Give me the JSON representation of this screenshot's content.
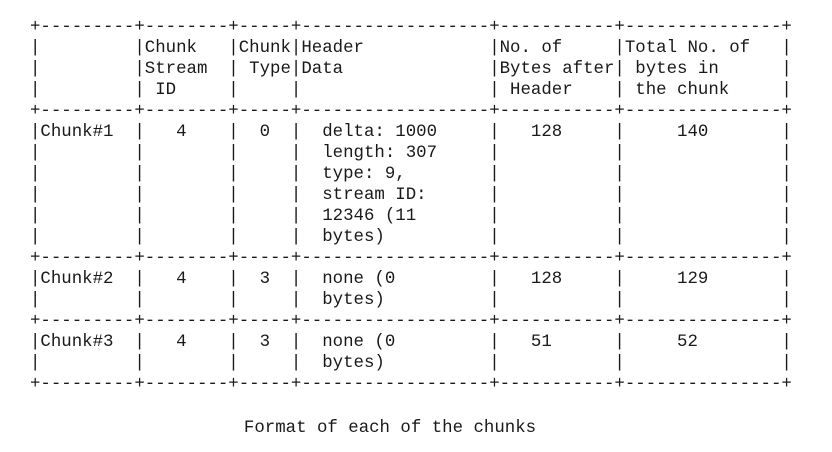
{
  "table_text": "+---------+--------+-----+------------------+-----------+---------------+\n|         |Chunk   |Chunk|Header            |No. of     |Total No. of   |\n|         |Stream  | Type|Data              |Bytes after| bytes in      |\n|         | ID     |     |                  | Header    | the chunk     |\n+---------+--------+-----+------------------+-----------+---------------+\n|Chunk#1  |   4    |  0  |  delta: 1000     |   128     |     140       |\n|         |        |     |  length: 307     |           |               |\n|         |        |     |  type: 9,        |           |               |\n|         |        |     |  stream ID:      |           |               |\n|         |        |     |  12346 (11       |           |               |\n|         |        |     |  bytes)          |           |               |\n+---------+--------+-----+------------------+-----------+---------------+\n|Chunk#2  |   4    |  3  |  none (0         |   128     |     129       |\n|         |        |     |  bytes)          |           |               |\n+---------+--------+-----+------------------+-----------+---------------+\n|Chunk#3  |   4    |  3  |  none (0         |   51      |     52        |\n|         |        |     |  bytes)          |           |               |\n+---------+--------+-----+------------------+-----------+---------------+",
  "caption": "Format of each of the chunks"
}
